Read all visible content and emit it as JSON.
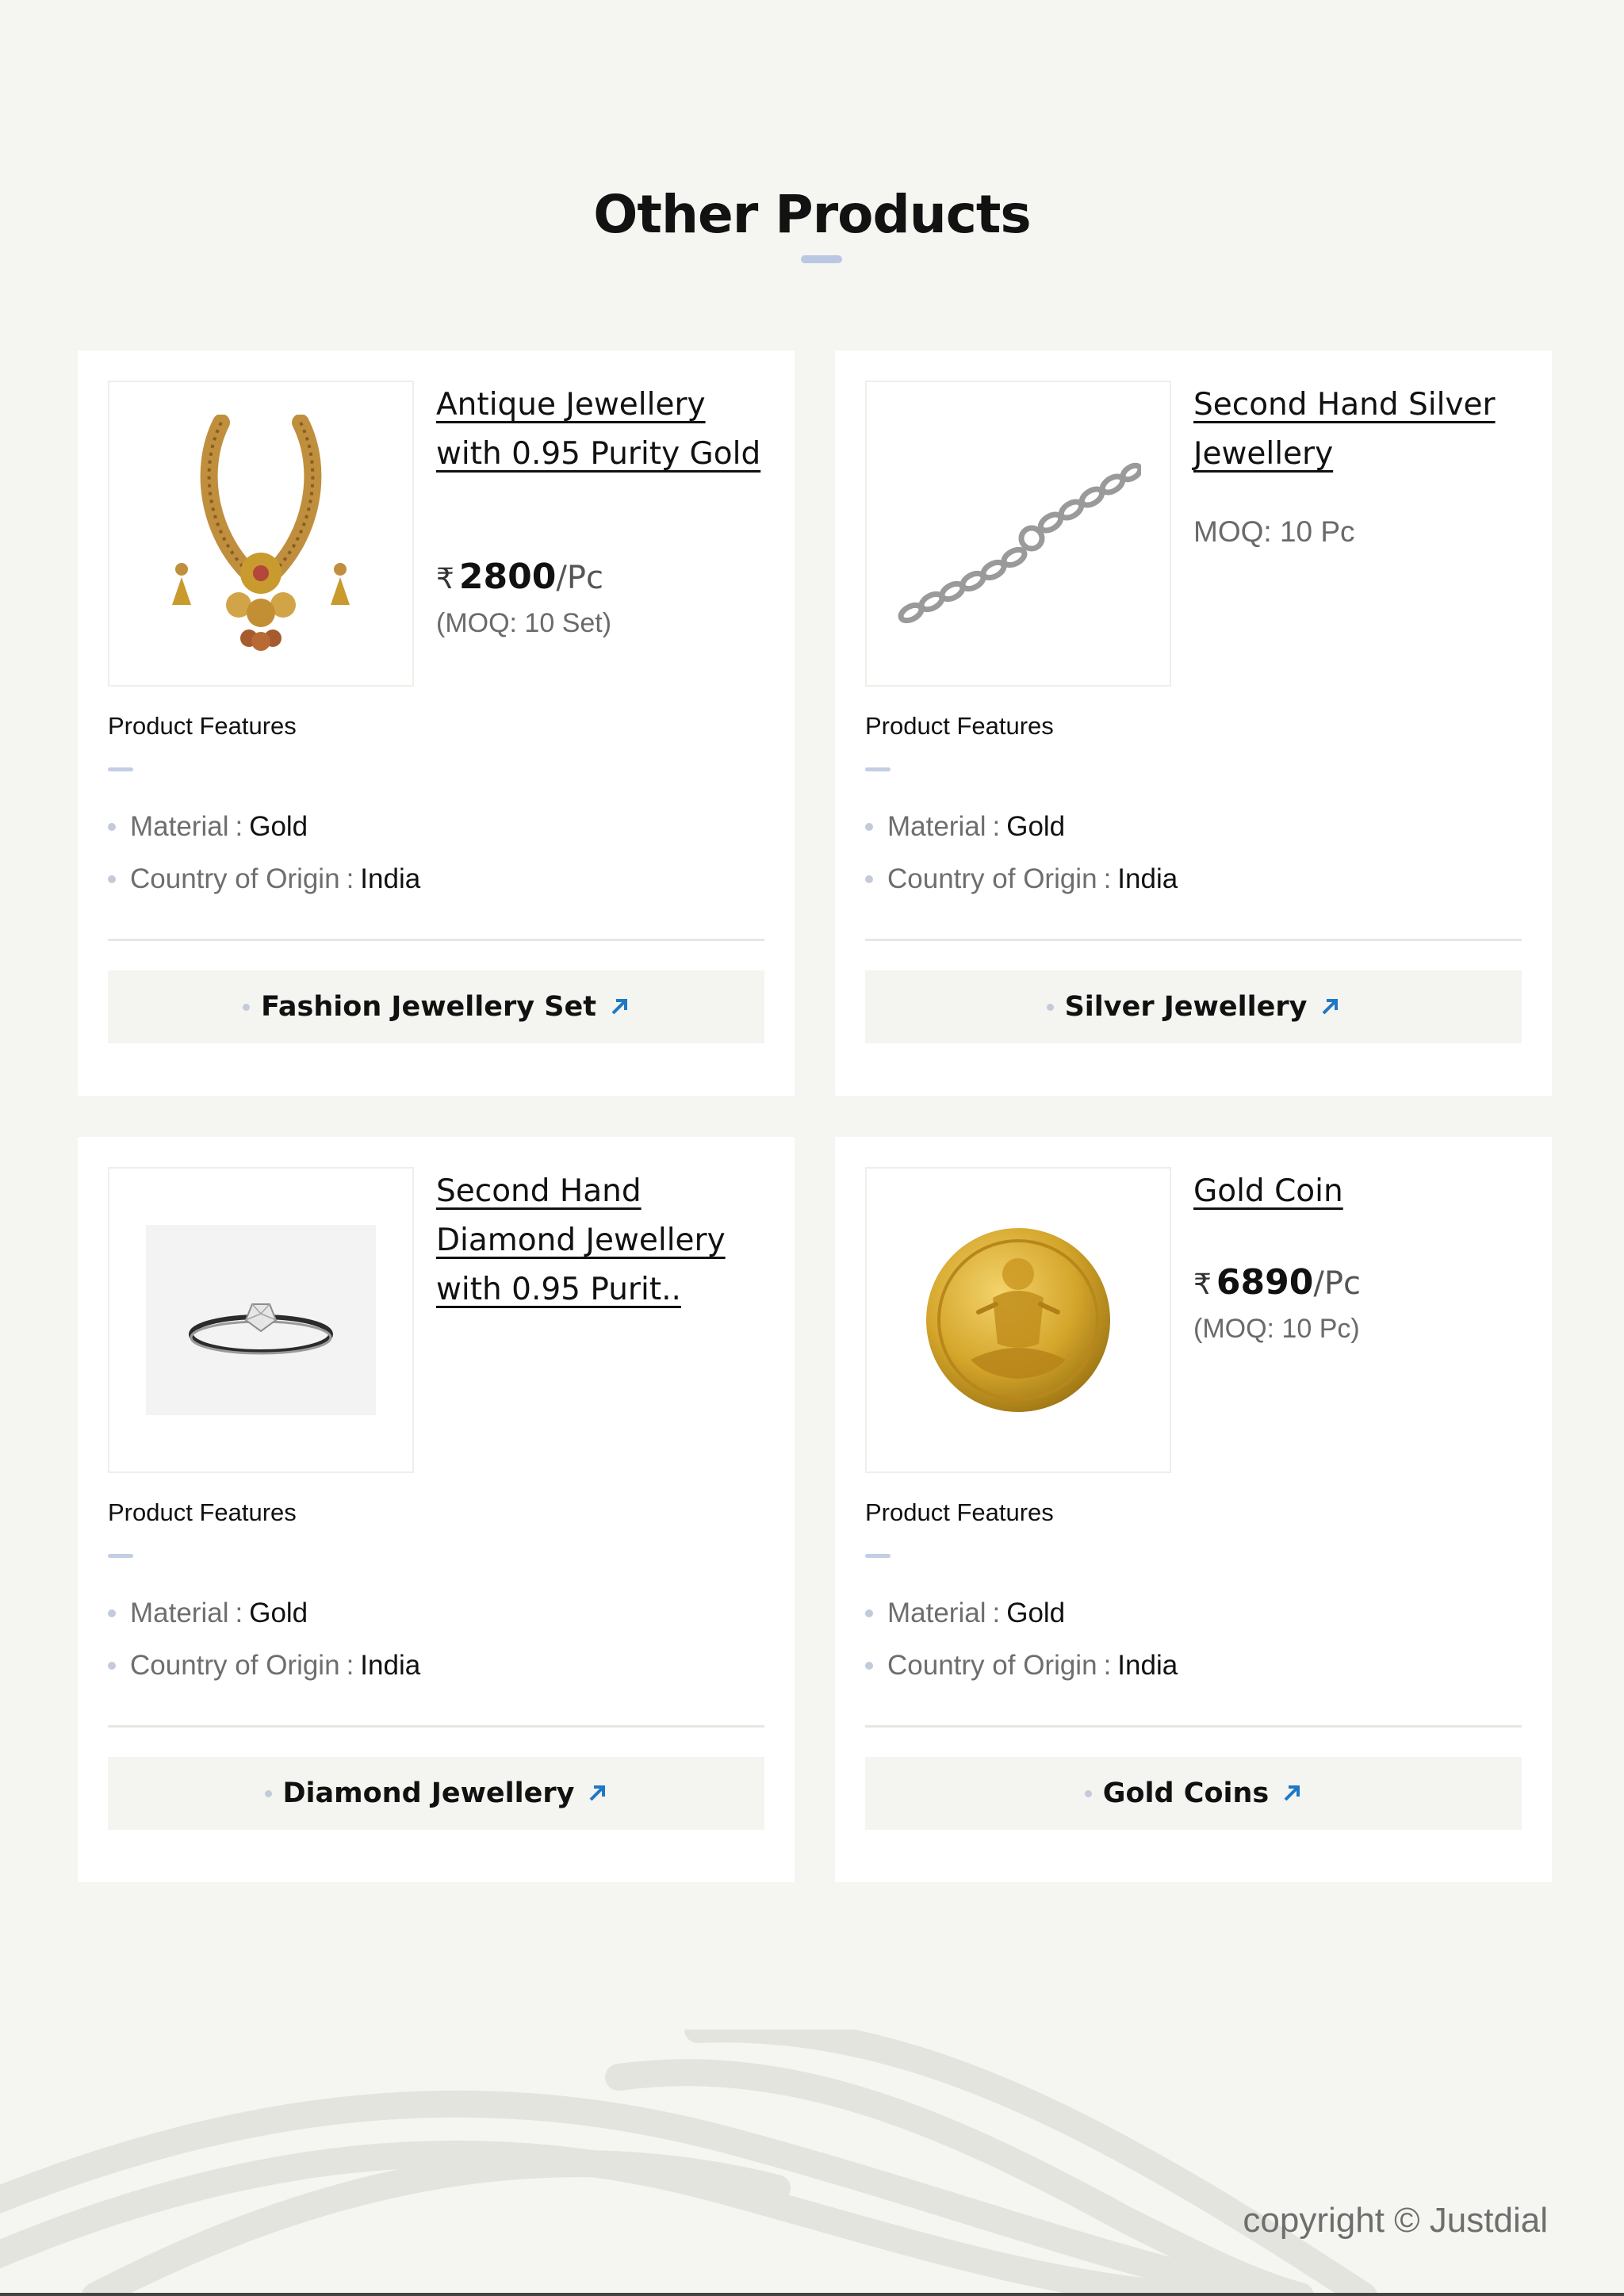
{
  "section": {
    "title": "Other Products"
  },
  "products": [
    {
      "title": "Antique Jewellery with 0.95 Purity Gold",
      "currency_symbol": "₹",
      "price": "2800",
      "unit": "/Pc",
      "moq": "(MOQ: 10 Set)",
      "image_icon": "gold-necklace-set-image",
      "features_heading": "Product Features",
      "features": [
        {
          "label": "Material",
          "value": "Gold"
        },
        {
          "label": "Country of Origin",
          "value": "India"
        }
      ],
      "category": "Fashion Jewellery Set"
    },
    {
      "title": "Second Hand Silver Jewellery",
      "moq": "MOQ: 10 Pc",
      "image_icon": "silver-chain-bracelet-image",
      "features_heading": "Product Features",
      "features": [
        {
          "label": "Material",
          "value": "Gold"
        },
        {
          "label": "Country of Origin",
          "value": "India"
        }
      ],
      "category": "Silver Jewellery"
    },
    {
      "title": "Second Hand Diamond Jewellery with 0.95 Purit..",
      "image_icon": "diamond-ring-image",
      "features_heading": "Product Features",
      "features": [
        {
          "label": "Material",
          "value": "Gold"
        },
        {
          "label": "Country of Origin",
          "value": "India"
        }
      ],
      "category": "Diamond Jewellery"
    },
    {
      "title": "Gold Coin",
      "currency_symbol": "₹",
      "price": "6890",
      "unit": "/Pc",
      "moq": "(MOQ: 10 Pc)",
      "image_icon": "gold-coin-image",
      "features_heading": "Product Features",
      "features": [
        {
          "label": "Material",
          "value": "Gold"
        },
        {
          "label": "Country of Origin",
          "value": "India"
        }
      ],
      "category": "Gold Coins"
    }
  ],
  "feature_separator": ":",
  "footer": {
    "copyright": "copyright © Justdial"
  },
  "colors": {
    "page_background": "#f5f5f1",
    "accent_line": "#b9c7e3",
    "link_arrow": "#1f78c6",
    "gold": "#c99a2e"
  }
}
